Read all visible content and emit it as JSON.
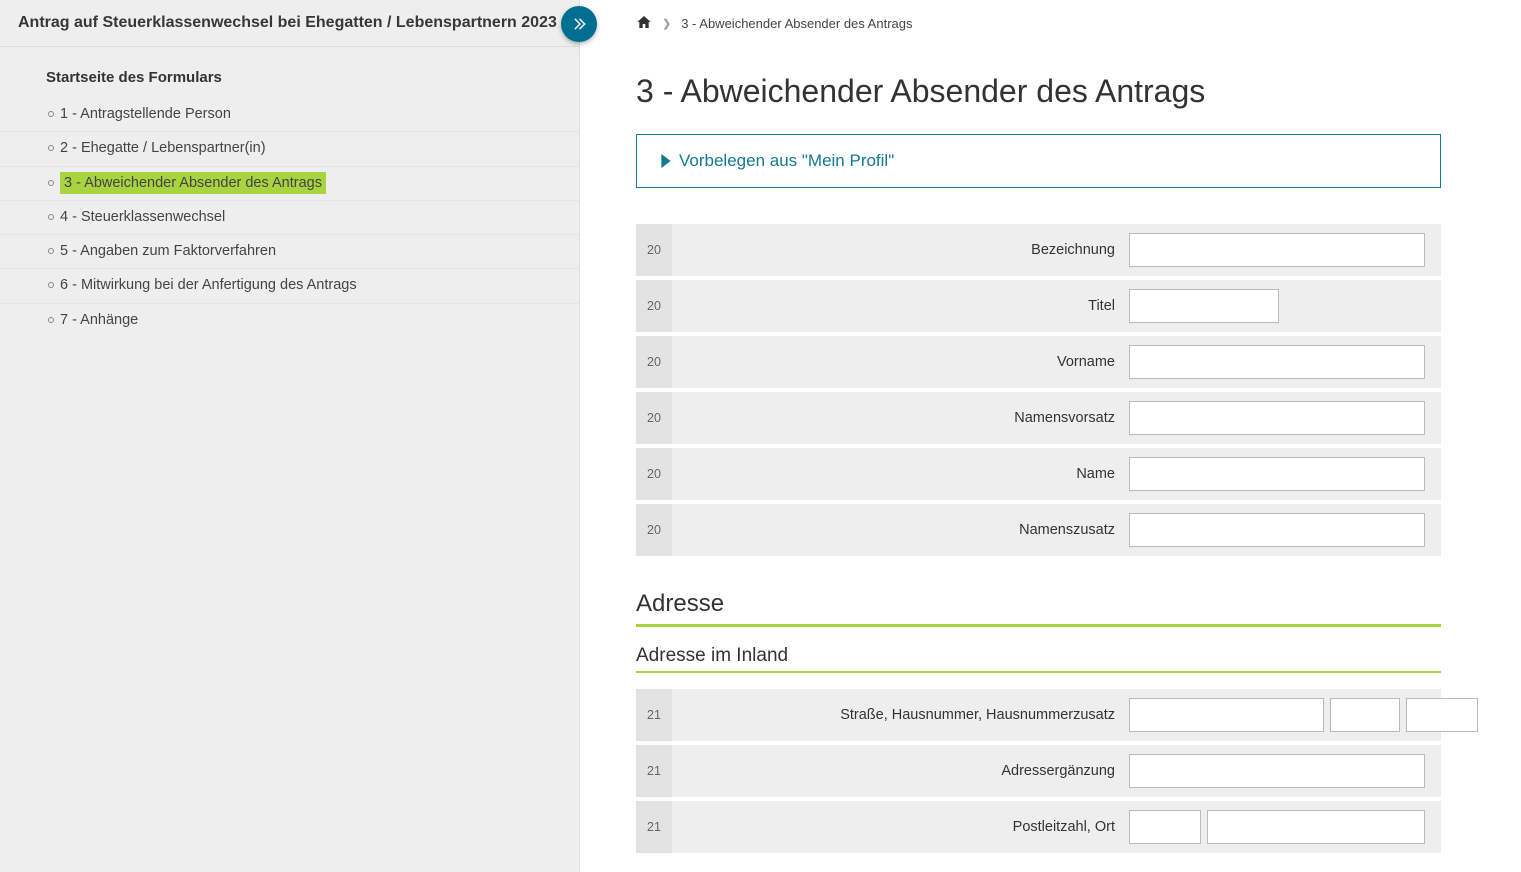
{
  "sidebar": {
    "title": "Antrag auf Steuerklassenwechsel bei Ehegatten / Lebenspartnern  2023",
    "nav_title": "Startseite des Formulars",
    "items": [
      {
        "label": "1 - Antragstellende Person"
      },
      {
        "label": "2 - Ehegatte / Lebenspartner(in)"
      },
      {
        "label": "3 - Abweichender Absender des Antrags"
      },
      {
        "label": "4 - Steuerklassenwechsel"
      },
      {
        "label": "5 - Angaben zum Faktorverfahren"
      },
      {
        "label": "6 - Mitwirkung bei der Anfertigung des Antrags"
      },
      {
        "label": "7 - Anhänge"
      }
    ]
  },
  "breadcrumb": {
    "current": "3 - Abweichender Absender des Antrags"
  },
  "main": {
    "title": "3 - Abweichender Absender des Antrags",
    "prefill": "Vorbelegen aus \"Mein Profil\"",
    "section_address": "Adresse",
    "section_address_inland": "Adresse im Inland",
    "fields": {
      "bezeichnung": {
        "num": "20",
        "label": "Bezeichnung"
      },
      "titel": {
        "num": "20",
        "label": "Titel"
      },
      "vorname": {
        "num": "20",
        "label": "Vorname"
      },
      "namensvorsatz": {
        "num": "20",
        "label": "Namensvorsatz"
      },
      "name": {
        "num": "20",
        "label": "Name"
      },
      "namenszusatz": {
        "num": "20",
        "label": "Namenszusatz"
      },
      "strasse": {
        "num": "21",
        "label": "Straße,  Hausnummer,  Hausnummerzusatz"
      },
      "adresserg": {
        "num": "21",
        "label": "Adressergänzung"
      },
      "plzort": {
        "num": "21",
        "label": "Postleitzahl,  Ort"
      }
    }
  }
}
